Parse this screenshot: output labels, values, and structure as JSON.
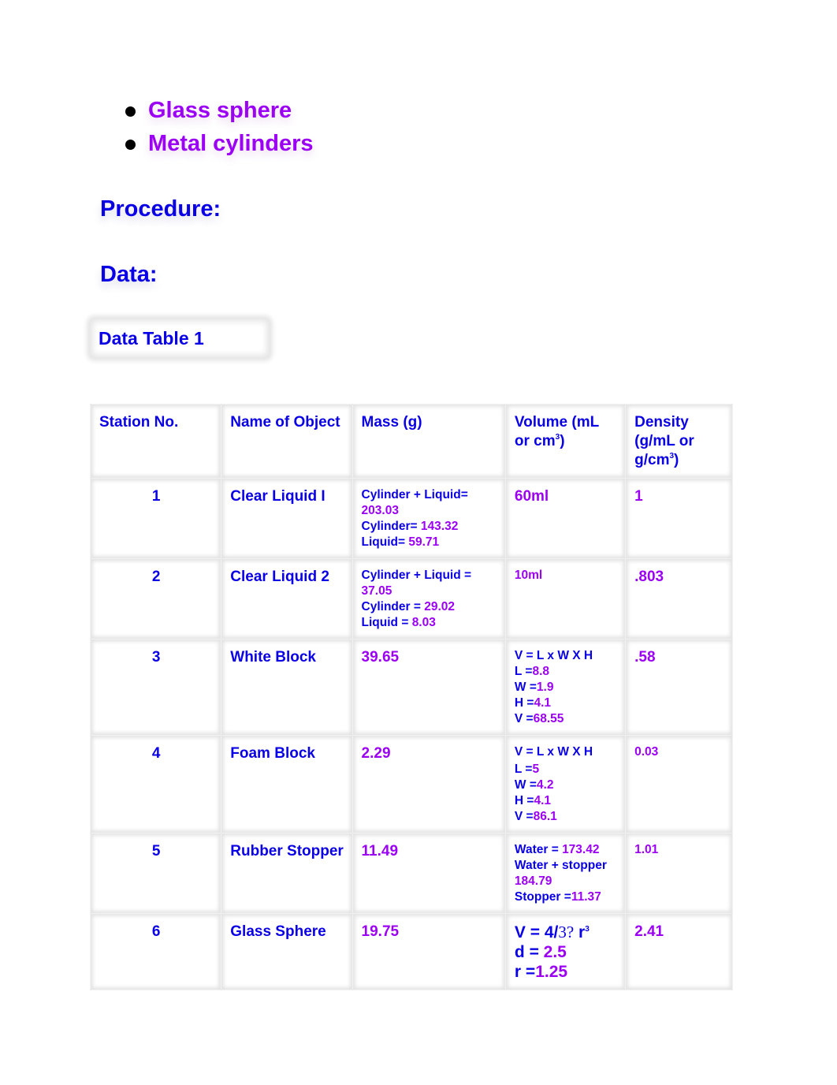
{
  "materials_list": [
    {
      "label": "Glass sphere"
    },
    {
      "label": "Metal cylinders"
    }
  ],
  "headings": {
    "procedure": "Procedure:",
    "data": "Data:"
  },
  "table_caption": "Data Table 1",
  "table": {
    "headers": {
      "station": "Station No.",
      "name": "Name of Object",
      "mass": "Mass (g)",
      "volume_prefix": "Volume (mL or cm",
      "volume_sup": "3",
      "volume_suffix": ")",
      "density_prefix": "Density (g/mL or g/cm",
      "density_sup": "3",
      "density_suffix": ")"
    },
    "rows": [
      {
        "station": "1",
        "name": "Clear Liquid I",
        "mass_lines": [
          {
            "label": "Cylinder + Liquid=",
            "value": ""
          },
          {
            "label": "",
            "value": "203.03"
          },
          {
            "label": "Cylinder= ",
            "value": "143.32"
          },
          {
            "label": "Liquid= ",
            "value": "59.71"
          }
        ],
        "volume": "60ml",
        "density": "1"
      },
      {
        "station": "2",
        "name": "Clear Liquid 2",
        "mass_lines": [
          {
            "label": "Cylinder + Liquid =",
            "value": ""
          },
          {
            "label": "",
            "value": "37.05"
          },
          {
            "label": "Cylinder = ",
            "value": "29.02"
          },
          {
            "label": "Liquid = ",
            "value": "8.03"
          }
        ],
        "volume": "10ml",
        "density": ".803"
      },
      {
        "station": "3",
        "name": "White Block",
        "mass": "39.65",
        "volume_lines": [
          {
            "label": "V = L x W X H",
            "value": ""
          },
          {
            "label": "L =",
            "value": "8.8"
          },
          {
            "label": "W =",
            "value": "1.9"
          },
          {
            "label": "H =",
            "value": "4.1"
          },
          {
            "label": "V =",
            "value": "68.55"
          }
        ],
        "density": ".58"
      },
      {
        "station": "4",
        "name": "Foam Block",
        "mass": "2.29",
        "volume_lines": [
          {
            "label": "V = L x W X H",
            "value": ""
          },
          {
            "label": "L =",
            "value": "5"
          },
          {
            "label": "W =",
            "value": "4.2"
          },
          {
            "label": "H =",
            "value": "4.1"
          },
          {
            "label": "V =",
            "value": "86.1"
          }
        ],
        "density": "0.03"
      },
      {
        "station": "5",
        "name": "Rubber Stopper",
        "mass": "11.49",
        "volume_lines": [
          {
            "label": "Water = ",
            "value": "173.42"
          },
          {
            "label": "Water + stopper",
            "value": ""
          },
          {
            "label": "",
            "value": "184.79"
          },
          {
            "label": "Stopper =",
            "value": "11.37"
          }
        ],
        "density": "1.01"
      },
      {
        "station": "6",
        "name": "Glass Sphere",
        "mass": "19.75",
        "volume_formula": {
          "prefix": "V = 4/",
          "serif_part": "3?",
          "suffix": " r",
          "sup": "3"
        },
        "volume_lines": [
          {
            "label": "d = ",
            "value": "2.5"
          },
          {
            "label": "r =",
            "value": "1.25"
          }
        ],
        "density": "2.41"
      }
    ]
  },
  "colors": {
    "label_blue": "#0a00e6",
    "value_purple": "#9b00f5"
  }
}
